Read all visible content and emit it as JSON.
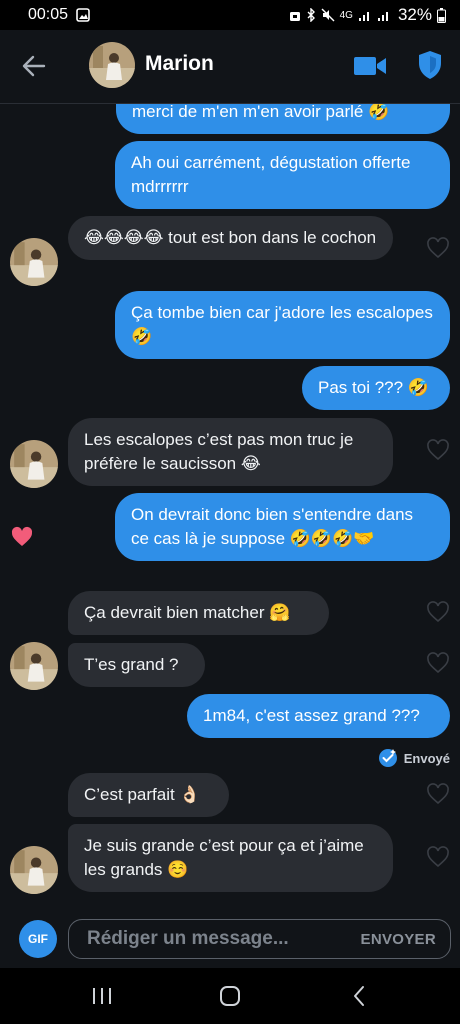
{
  "status_bar": {
    "time": "00:05",
    "network": "4G",
    "battery": "32%"
  },
  "header": {
    "contact_name": "Marion"
  },
  "messages": [
    {
      "side": "out",
      "text": "merci de m'en m'en avoir parlé 🤣"
    },
    {
      "side": "out",
      "text": "Ah oui carrément, dégustation offerte mdrrrrrr"
    },
    {
      "side": "in",
      "text": "😂😂😂😂 tout est bon dans le cochon"
    },
    {
      "side": "out",
      "text": "Ça tombe bien car j'adore les escalopes 🤣"
    },
    {
      "side": "out",
      "text": "Pas toi ??? 🤣"
    },
    {
      "side": "in",
      "text": "Les escalopes c’est pas mon truc je préfère le saucisson 😂"
    },
    {
      "side": "out",
      "text": "On devrait donc bien s'entendre dans ce cas là je suppose 🤣🤣🤣🤝"
    },
    {
      "side": "in",
      "text": "Ça devrait bien matcher 🤗"
    },
    {
      "side": "in",
      "text": "T’es grand ?"
    },
    {
      "side": "out",
      "text": "1m84, c'est assez grand ???"
    },
    {
      "side": "in",
      "text": "C’est parfait 👌🏻"
    },
    {
      "side": "in",
      "text": "Je suis grande c’est pour ça et j’aime les grands ☺️"
    }
  ],
  "sent_status": "Envoyé",
  "composer": {
    "gif_label": "GIF",
    "placeholder": "Rédiger un message...",
    "send_label": "ENVOYER"
  },
  "colors": {
    "outgoing_bubble": "#2f8fe8",
    "incoming_bubble": "#2a2d33",
    "liked_heart": "#f25c7a",
    "background": "#111418"
  }
}
